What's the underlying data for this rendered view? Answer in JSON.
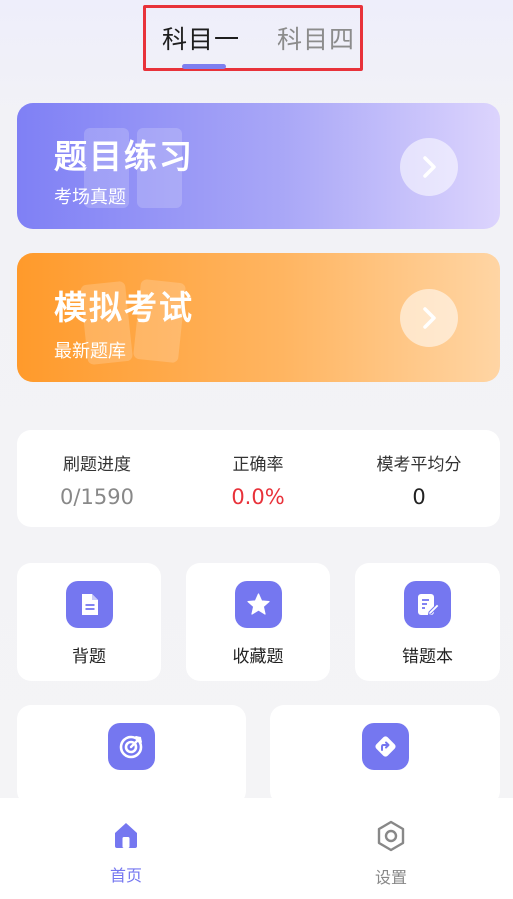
{
  "tabs": [
    {
      "label": "科目一",
      "active": true
    },
    {
      "label": "科目四",
      "active": false
    }
  ],
  "cards": {
    "practice": {
      "title": "题目练习",
      "subtitle": "考场真题"
    },
    "exam": {
      "title": "模拟考试",
      "subtitle": "最新题库"
    }
  },
  "stats": [
    {
      "label": "刷题进度",
      "value": "0/1590"
    },
    {
      "label": "正确率",
      "value": "0.0%"
    },
    {
      "label": "模考平均分",
      "value": "0"
    }
  ],
  "tiles": [
    {
      "label": "背题",
      "icon": "document-icon"
    },
    {
      "label": "收藏题",
      "icon": "star-icon"
    },
    {
      "label": "错题本",
      "icon": "edit-list-icon"
    },
    {
      "label": "",
      "icon": "target-icon"
    },
    {
      "label": "",
      "icon": "direction-sign-icon"
    }
  ],
  "bottom_nav": [
    {
      "label": "首页",
      "icon": "home-icon",
      "active": true
    },
    {
      "label": "设置",
      "icon": "settings-icon",
      "active": false
    }
  ],
  "colors": {
    "accent": "#7577f0",
    "practice_gradient_start": "#7f80f5",
    "exam_gradient_start": "#ff9a2b",
    "error_red": "#e8323a"
  }
}
